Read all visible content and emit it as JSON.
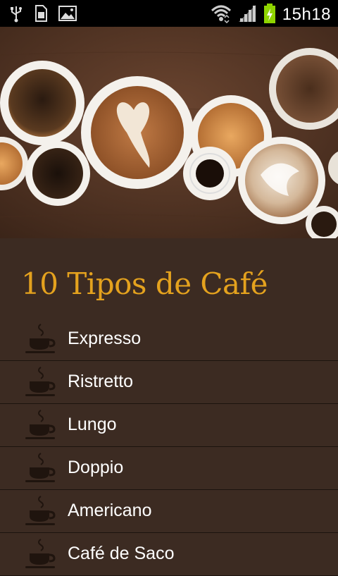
{
  "status_bar": {
    "time": "15h18"
  },
  "header": {
    "title": "10 Tipos de Café"
  },
  "list": {
    "items": [
      {
        "label": "Expresso"
      },
      {
        "label": "Ristretto"
      },
      {
        "label": "Lungo"
      },
      {
        "label": "Doppio"
      },
      {
        "label": "Americano"
      },
      {
        "label": "Café de Saco"
      }
    ]
  },
  "colors": {
    "background": "#3c2b22",
    "accent": "#e4a21e",
    "status_bar": "#000000"
  },
  "icons": [
    "usb-icon",
    "sim-card-icon",
    "picture-icon",
    "wifi-icon",
    "signal-icon",
    "battery-charging-icon",
    "coffee-cup-icon"
  ]
}
